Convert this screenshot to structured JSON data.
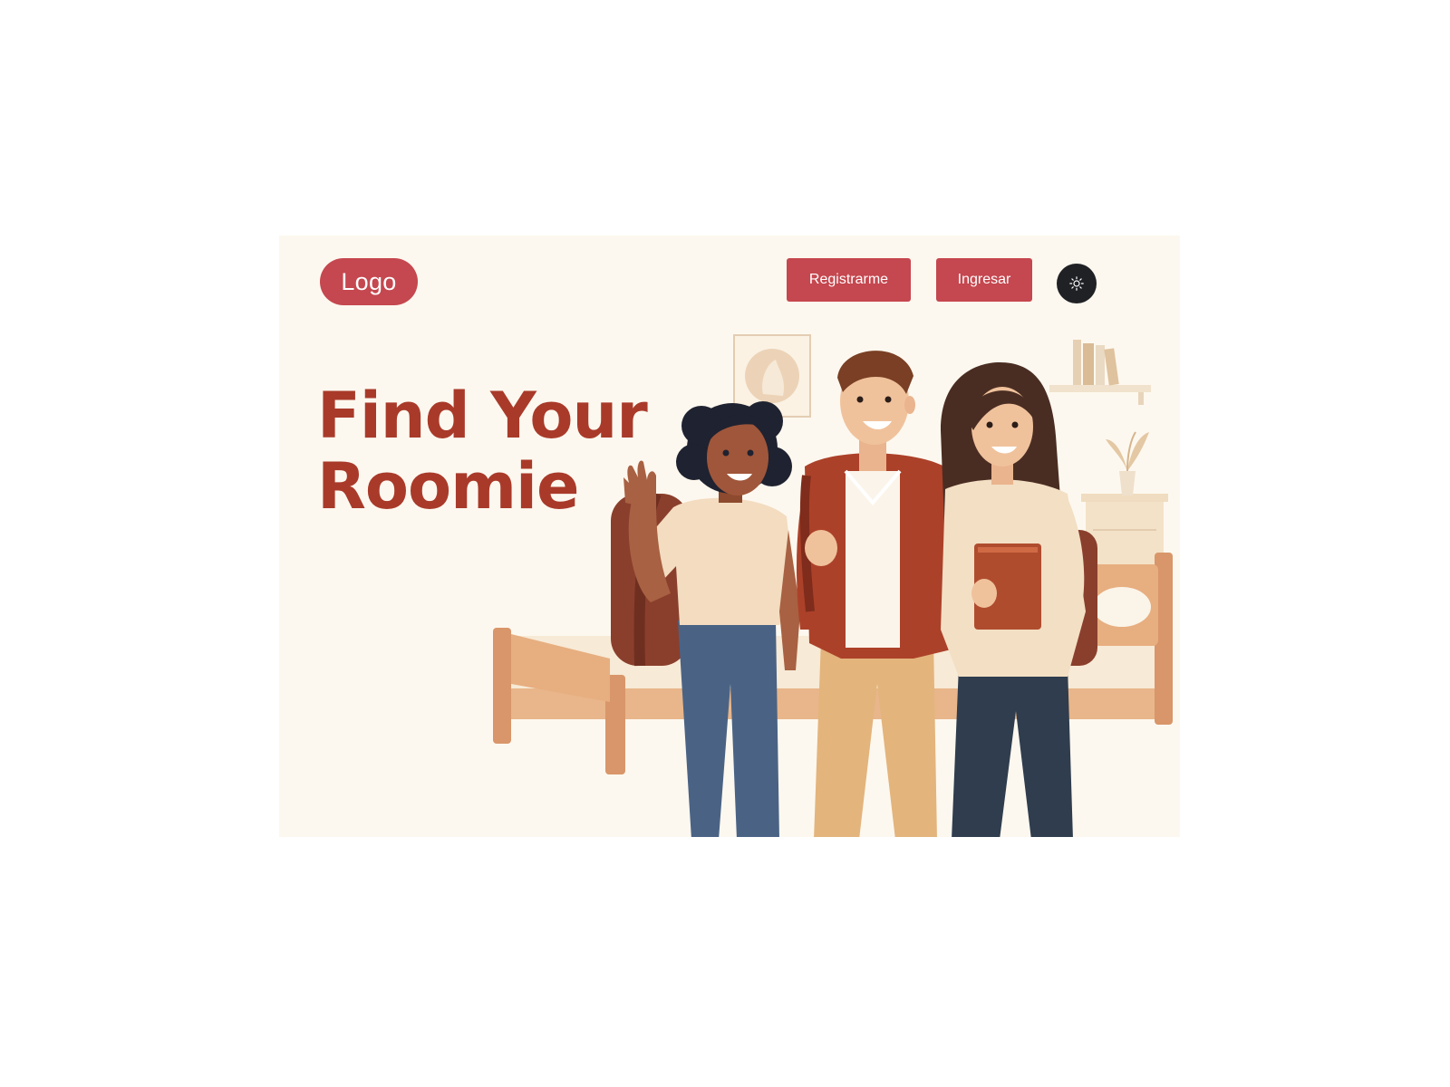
{
  "header": {
    "logo_label": "Logo",
    "register_label": "Registrarme",
    "login_label": "Ingresar",
    "theme_icon": "sun-icon"
  },
  "hero": {
    "title_line1": "Find Your",
    "title_line2": "Roomie",
    "illustration": "three-students-in-dorm-room"
  },
  "colors": {
    "background": "#fdf8ef",
    "accent": "#c5474f",
    "title": "#a93a2a",
    "toggle": "#1f2125"
  }
}
